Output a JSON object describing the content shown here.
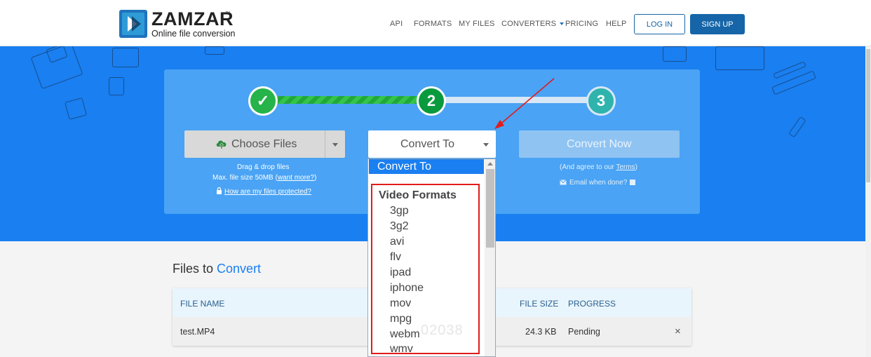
{
  "header": {
    "logo_name": "ZAMZAR",
    "logo_tm": "™",
    "logo_sub": "Online file conversion",
    "nav": [
      "API",
      "FORMATS",
      "MY FILES",
      "CONVERTERS",
      "PRICING",
      "HELP"
    ],
    "login": "LOG IN",
    "signup": "SIGN UP"
  },
  "steps": {
    "step1": "✓",
    "step2": "2",
    "step3": "3"
  },
  "upload": {
    "choose_files": "Choose Files",
    "drag_drop": "Drag & drop files",
    "max_size_prefix": "Max. file size 50MB (",
    "want_more": "want more?",
    "max_size_suffix": ")",
    "protected": "How are my files protected?"
  },
  "convert": {
    "convert_to": "Convert To",
    "convert_now": "Convert Now",
    "agree_prefix": "(And agree to our ",
    "terms": "Terms",
    "agree_suffix": ")",
    "email_when_done": "Email when done?"
  },
  "files": {
    "title_prefix": "Files to ",
    "title_accent": "Convert",
    "columns": [
      "FILE NAME",
      "FILE SIZE",
      "PROGRESS"
    ],
    "rows": [
      {
        "name": "test.MP4",
        "size": "24.3 KB",
        "progress": "Pending"
      }
    ]
  },
  "dropdown": {
    "selected": "Convert To",
    "group": "Video Formats",
    "items": [
      "3gp",
      "3g2",
      "avi",
      "flv",
      "ipad",
      "iphone",
      "mov",
      "mpg",
      "webm",
      "wmv"
    ]
  },
  "watermark": "02038",
  "colors": {
    "brand_blue": "#1a7ff0",
    "dark_blue": "#1565a8",
    "success_green": "#26b34a",
    "highlight_red": "#e21b1b"
  }
}
